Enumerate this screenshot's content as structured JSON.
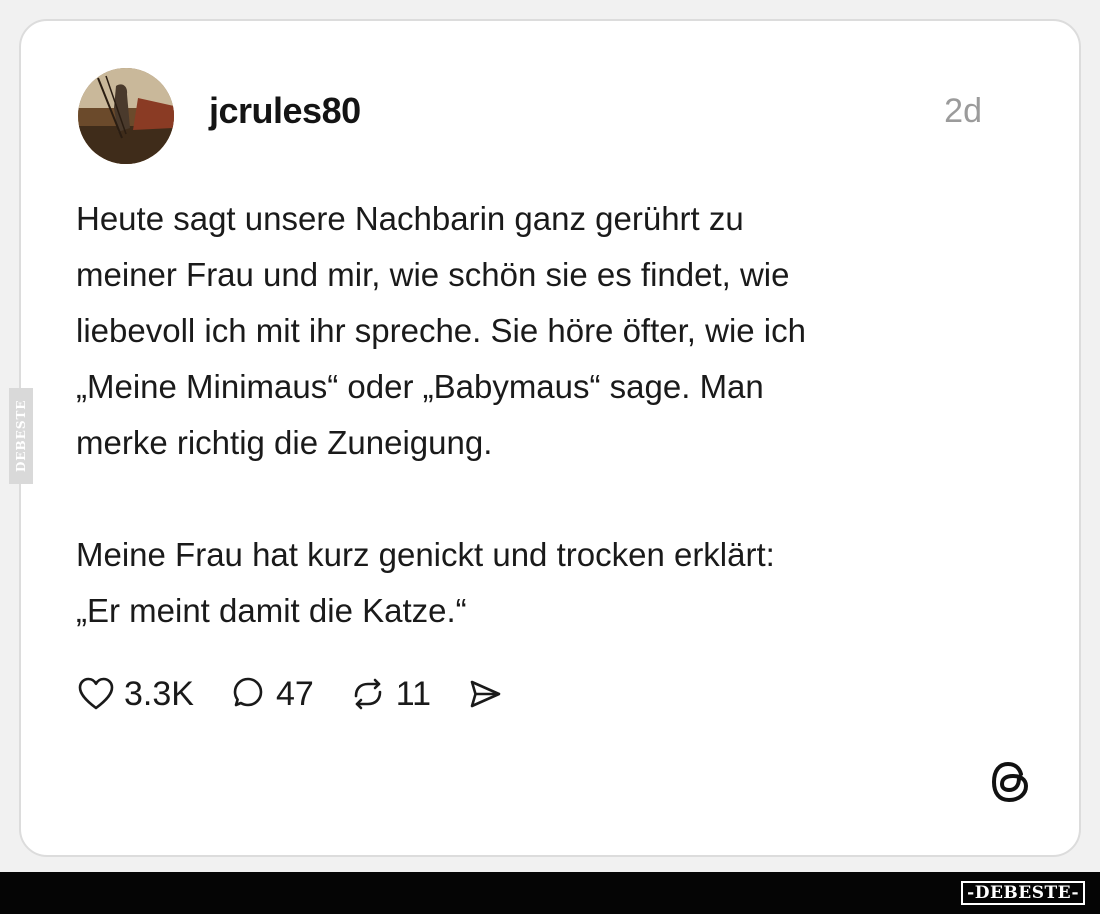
{
  "post": {
    "username": "jcrules80",
    "timestamp": "2d",
    "paragraphs": [
      "Heute sagt unsere Nachbarin ganz gerührt zu\nmeiner Frau und mir, wie schön sie es findet, wie\nliebevoll ich mit ihr spreche. Sie höre öfter, wie ich\n„Meine Minimaus“ oder „Babymaus“ sage. Man\nmerke richtig die Zuneigung.",
      "Meine Frau hat kurz genickt und trocken erklärt:\n„Er meint damit die Katze.“"
    ]
  },
  "actions": {
    "like_count": "3.3K",
    "comment_count": "47",
    "repost_count": "11"
  },
  "icons": {
    "like": "heart-icon",
    "comment": "comment-bubble-icon",
    "repost": "repost-icon",
    "share": "send-icon",
    "brand": "threads-logo-icon"
  },
  "watermarks": {
    "side": "DEBESTE",
    "footer": "-DEBESTE-"
  },
  "colors": {
    "card_background": "#ffffff",
    "page_background": "#f1f1f1",
    "text": "#1a1a1a",
    "timestamp": "#9b9b9b",
    "footer_bar": "#050505"
  }
}
